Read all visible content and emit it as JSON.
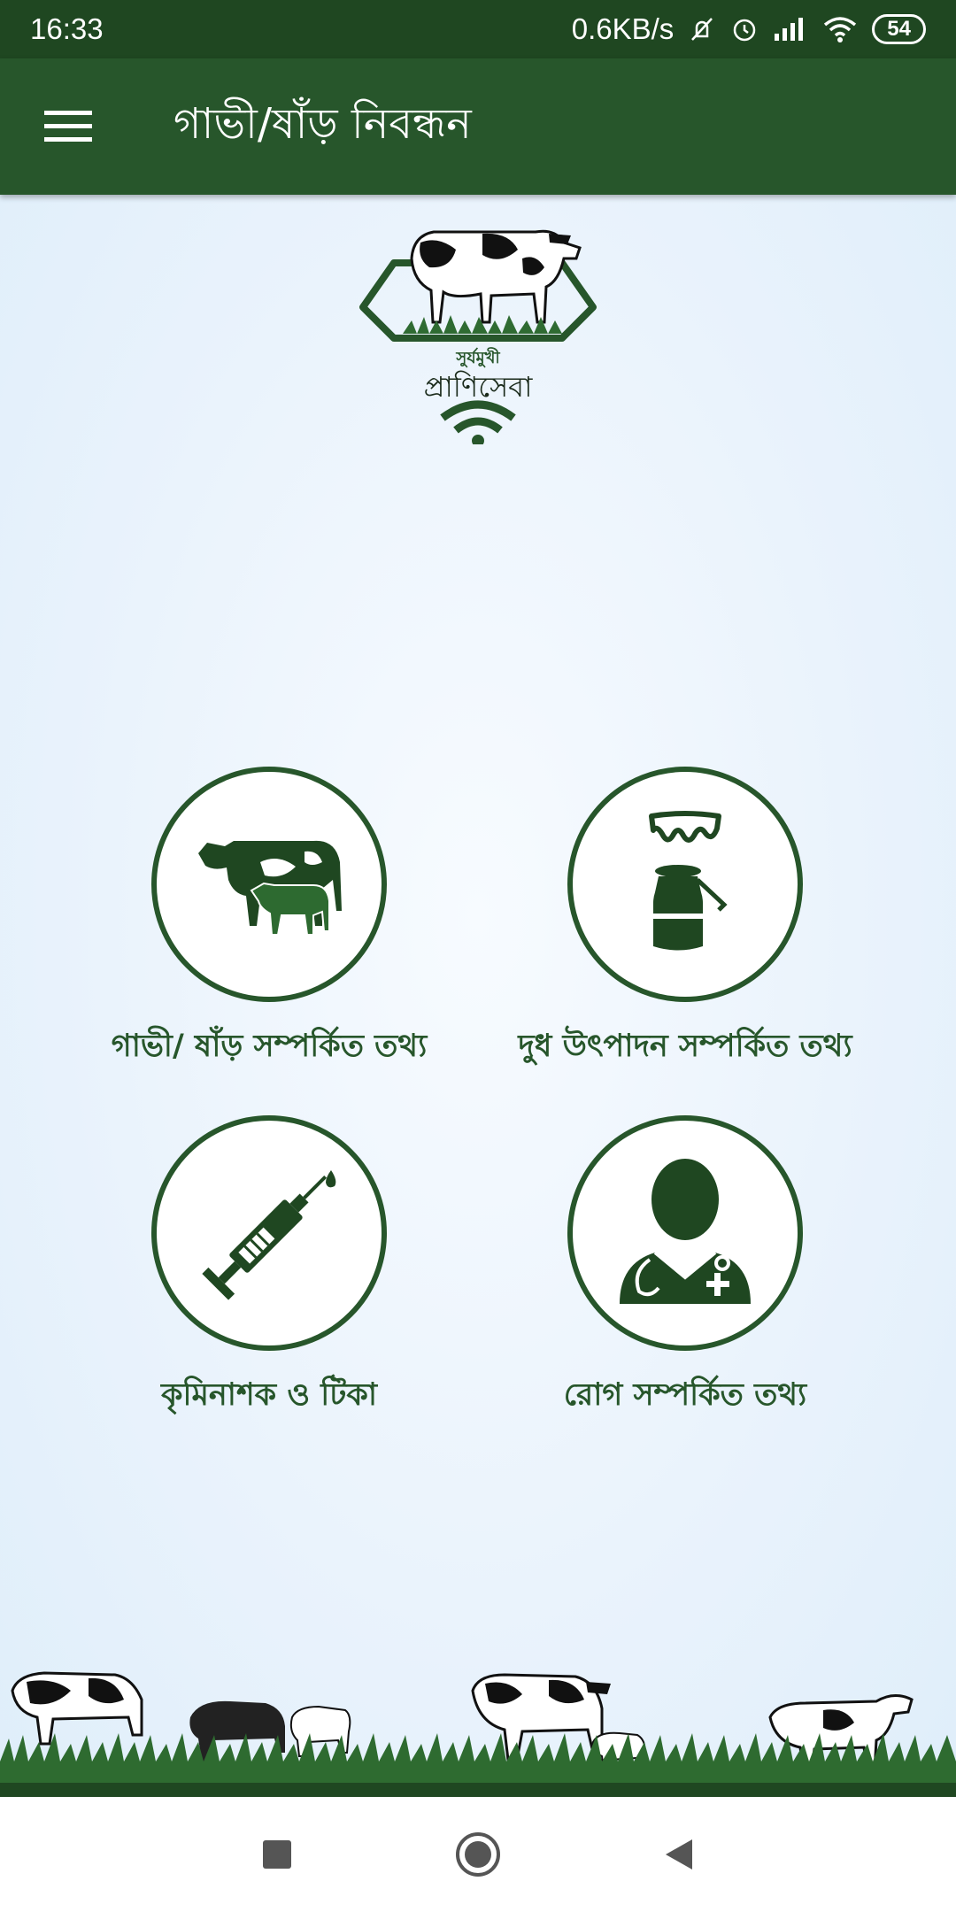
{
  "status_bar": {
    "time": "16:33",
    "network_speed": "0.6KB/s",
    "battery": "54",
    "icons": [
      "mute-icon",
      "alarm-icon",
      "signal-icon",
      "wifi-icon",
      "battery-icon"
    ]
  },
  "app_bar": {
    "title": "গাভী/ষাঁড় নিবন্ধন",
    "menu_icon": "hamburger-icon"
  },
  "logo": {
    "caption_top": "সুর্যমুখী",
    "caption": "প্রাণিসেবা"
  },
  "tiles": [
    {
      "label": "গাভী/ ষাঁড় সম্পর্কিত তথ্য",
      "icon": "cattle-icon"
    },
    {
      "label": "দুধ উৎপাদন সম্পর্কিত তথ্য",
      "icon": "milk-can-icon"
    },
    {
      "label": "কৃমিনাশক ও টিকা",
      "icon": "syringe-icon"
    },
    {
      "label": "রোগ সম্পর্কিত তথ্য",
      "icon": "doctor-icon"
    }
  ],
  "colors": {
    "primary": "#27562b",
    "status_bar": "#1f4721",
    "background": "#eaf3fc"
  },
  "nav_bar": {
    "icons": [
      "recent-apps-icon",
      "home-icon",
      "back-icon"
    ]
  }
}
